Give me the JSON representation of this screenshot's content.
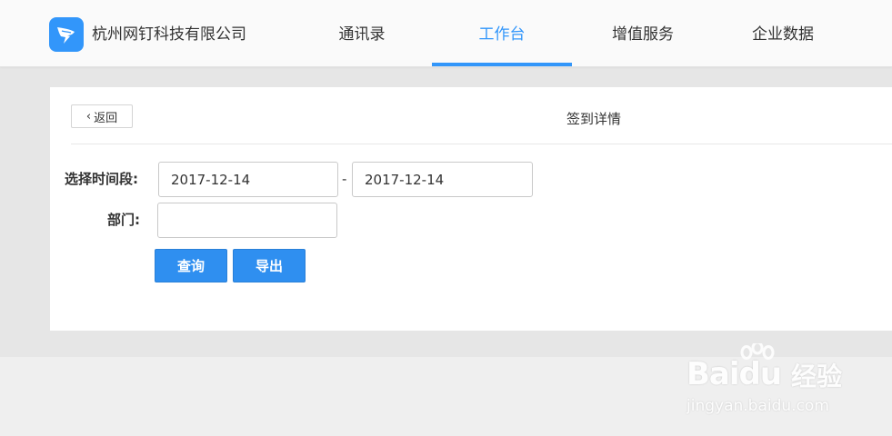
{
  "header": {
    "company_name": "杭州网钉科技有限公司",
    "tabs": [
      {
        "label": "通讯录",
        "active": false
      },
      {
        "label": "工作台",
        "active": true
      },
      {
        "label": "增值服务",
        "active": false
      },
      {
        "label": "企业数据",
        "active": false
      }
    ],
    "brand_color": "#3296fa"
  },
  "panel": {
    "back_label": "返回",
    "title": "签到详情"
  },
  "form": {
    "date_range_label": "选择时间段:",
    "start_date": "2017-12-14",
    "range_separator": "-",
    "end_date": "2017-12-14",
    "department_label": "部门:",
    "department_value": "",
    "query_button": "查询",
    "export_button": "导出"
  },
  "watermark": {
    "brand": "Baidu",
    "suffix": "经验",
    "url": "jingyan.baidu.com"
  }
}
